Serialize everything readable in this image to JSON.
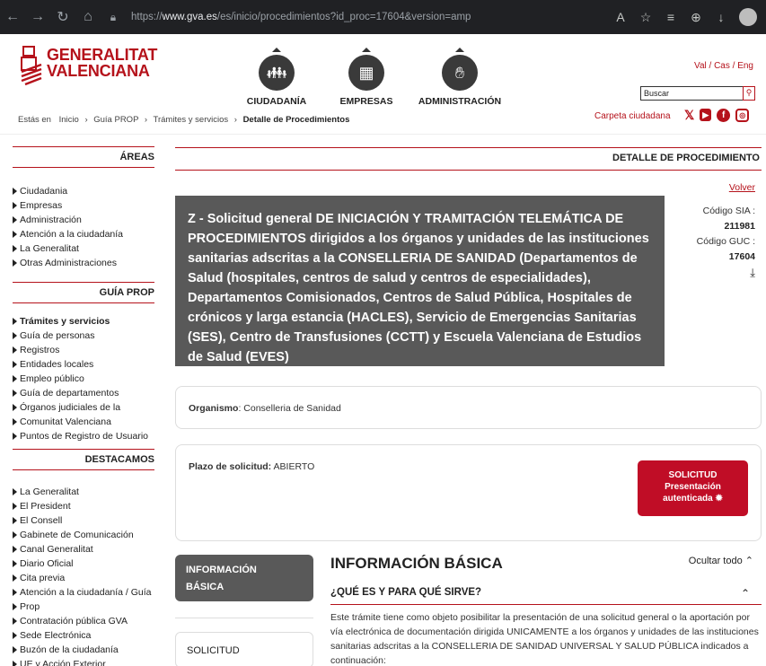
{
  "browser": {
    "url_prefix": "https://",
    "url_domain": "www.gva.es",
    "url_path": "/es/inicio/procedimientos?id_proc=17604&version=amp"
  },
  "header": {
    "logo_line1": "GENERALITAT",
    "logo_line2": "VALENCIANA",
    "sections": [
      {
        "label": "CIUDADANÍA",
        "icon": "people-icon"
      },
      {
        "label": "EMPRESAS",
        "icon": "building-icon"
      },
      {
        "label": "ADMINISTRACIÓN",
        "icon": "handshake-icon"
      }
    ],
    "lang": "Val / Cas / Eng",
    "search_placeholder": "Buscar"
  },
  "breadcrumb": {
    "prefix": "Estás en",
    "items": [
      "Inicio",
      "Guía PROP",
      "Trámites y servicios"
    ],
    "current": "Detalle de Procedimientos"
  },
  "carpeta": "Carpeta ciudadana",
  "sidebar": {
    "areas_title": "ÁREAS",
    "areas": [
      "Ciudadania",
      "Empresas",
      "Administración",
      "Atención a la ciudadanía",
      "La Generalitat",
      "Otras Administraciones"
    ],
    "guia_title": "GUÍA PROP",
    "guia": [
      "Trámites y servicios",
      "Guía de personas",
      "Registros",
      "Entidades locales",
      "Empleo público",
      "Guía de departamentos",
      "Órganos judiciales de la",
      "Comunitat Valenciana",
      "Puntos de Registro de Usuario"
    ],
    "destacamos_title": "DESTACAMOS",
    "destacamos": [
      "La Generalitat",
      "El President",
      "El Consell",
      "Gabinete de Comunicación",
      "Canal Generalitat",
      "Diario Oficial",
      "Cita previa",
      "Atención a la ciudadanía / Guía",
      "Prop",
      "Contratación pública GVA",
      "Sede Electrónica",
      "Buzón de la ciudadanía",
      "UE y Acción Exterior"
    ]
  },
  "main": {
    "section_title": "DETALLE DE PROCEDIMIENTO",
    "volver": "Volver",
    "title": "Z - Solicitud general DE INICIACIÓN Y TRAMITACIÓN TELEMÁTICA DE PROCEDIMIENTOS dirigidos a los órganos y unidades de las instituciones sanitarias adscritas a la CONSELLERIA DE SANIDAD (Departamentos de Salud (hospitales, centros de salud y centros de especialidades), Departamentos Comisionados, Centros de Salud Pública, Hospitales de crónicos y larga estancia (HACLES), Servicio de Emergencias Sanitarias (SES), Centro de Transfusiones (CCTT) y Escuela Valenciana de Estudios de Salud (EVES)",
    "codigo_sia_label": "Código SIA :",
    "codigo_sia": "211981",
    "codigo_guc_label": "Código GUC :",
    "codigo_guc": "17604",
    "organismo_label": "Organismo",
    "organismo": ": Conselleria de Sanidad",
    "plazo_label": "Plazo de solicitud:",
    "plazo": "ABIERTO",
    "solicitud_btn_line1": "SOLICITUD",
    "solicitud_btn_line2": "Presentación",
    "solicitud_btn_line3": "autenticada",
    "tab_info_line1": "INFORMACIÓN",
    "tab_info_line2": "BÁSICA",
    "tab_solicitud": "SOLICITUD",
    "info_title": "INFORMACIÓN BÁSICA",
    "ocultar": "Ocultar todo",
    "que_es": "¿QUÉ ES Y PARA QUÉ SIRVE?",
    "desc": "Este trámite tiene como objeto posibilitar la presentación de una solicitud general o la aportación por vía electrónica de documentación dirigida UNICAMENTE a los órganos y unidades de las instituciones sanitarias adscritas a la CONSELLERIA DE SANIDAD UNIVERSAL Y SALUD PÚBLICA indicados a continuación:"
  },
  "colors": {
    "brand": "#b5121b",
    "title_bg": "#595959",
    "button": "#c00d26"
  }
}
